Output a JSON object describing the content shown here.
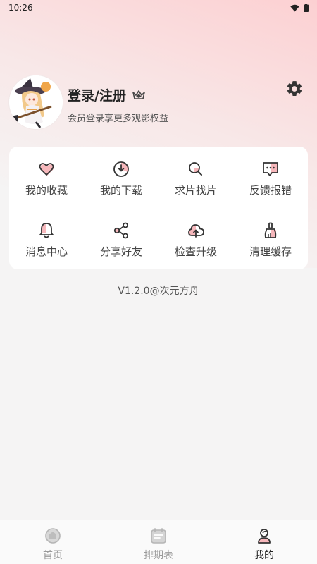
{
  "status_bar": {
    "time": "10:26"
  },
  "profile": {
    "title": "登录/注册",
    "subtitle": "会员登录享更多观影权益"
  },
  "menu": {
    "items": [
      {
        "label": "我的收藏",
        "icon": "heart-icon"
      },
      {
        "label": "我的下载",
        "icon": "download-icon"
      },
      {
        "label": "求片找片",
        "icon": "search-icon"
      },
      {
        "label": "反馈报错",
        "icon": "feedback-icon"
      },
      {
        "label": "消息中心",
        "icon": "bell-icon"
      },
      {
        "label": "分享好友",
        "icon": "share-icon"
      },
      {
        "label": "检查升级",
        "icon": "cloud-upload-icon"
      },
      {
        "label": "清理缓存",
        "icon": "broom-icon"
      }
    ]
  },
  "version": "V1.2.0@次元方舟",
  "tabbar": {
    "tabs": [
      {
        "label": "首页",
        "icon": "home-icon",
        "active": false
      },
      {
        "label": "排期表",
        "icon": "calendar-icon",
        "active": false
      },
      {
        "label": "我的",
        "icon": "user-icon",
        "active": true
      }
    ]
  },
  "colors": {
    "accent_pink": "#f6b7bb",
    "text_dark": "#222222",
    "tab_inactive": "#9a9a9a"
  }
}
